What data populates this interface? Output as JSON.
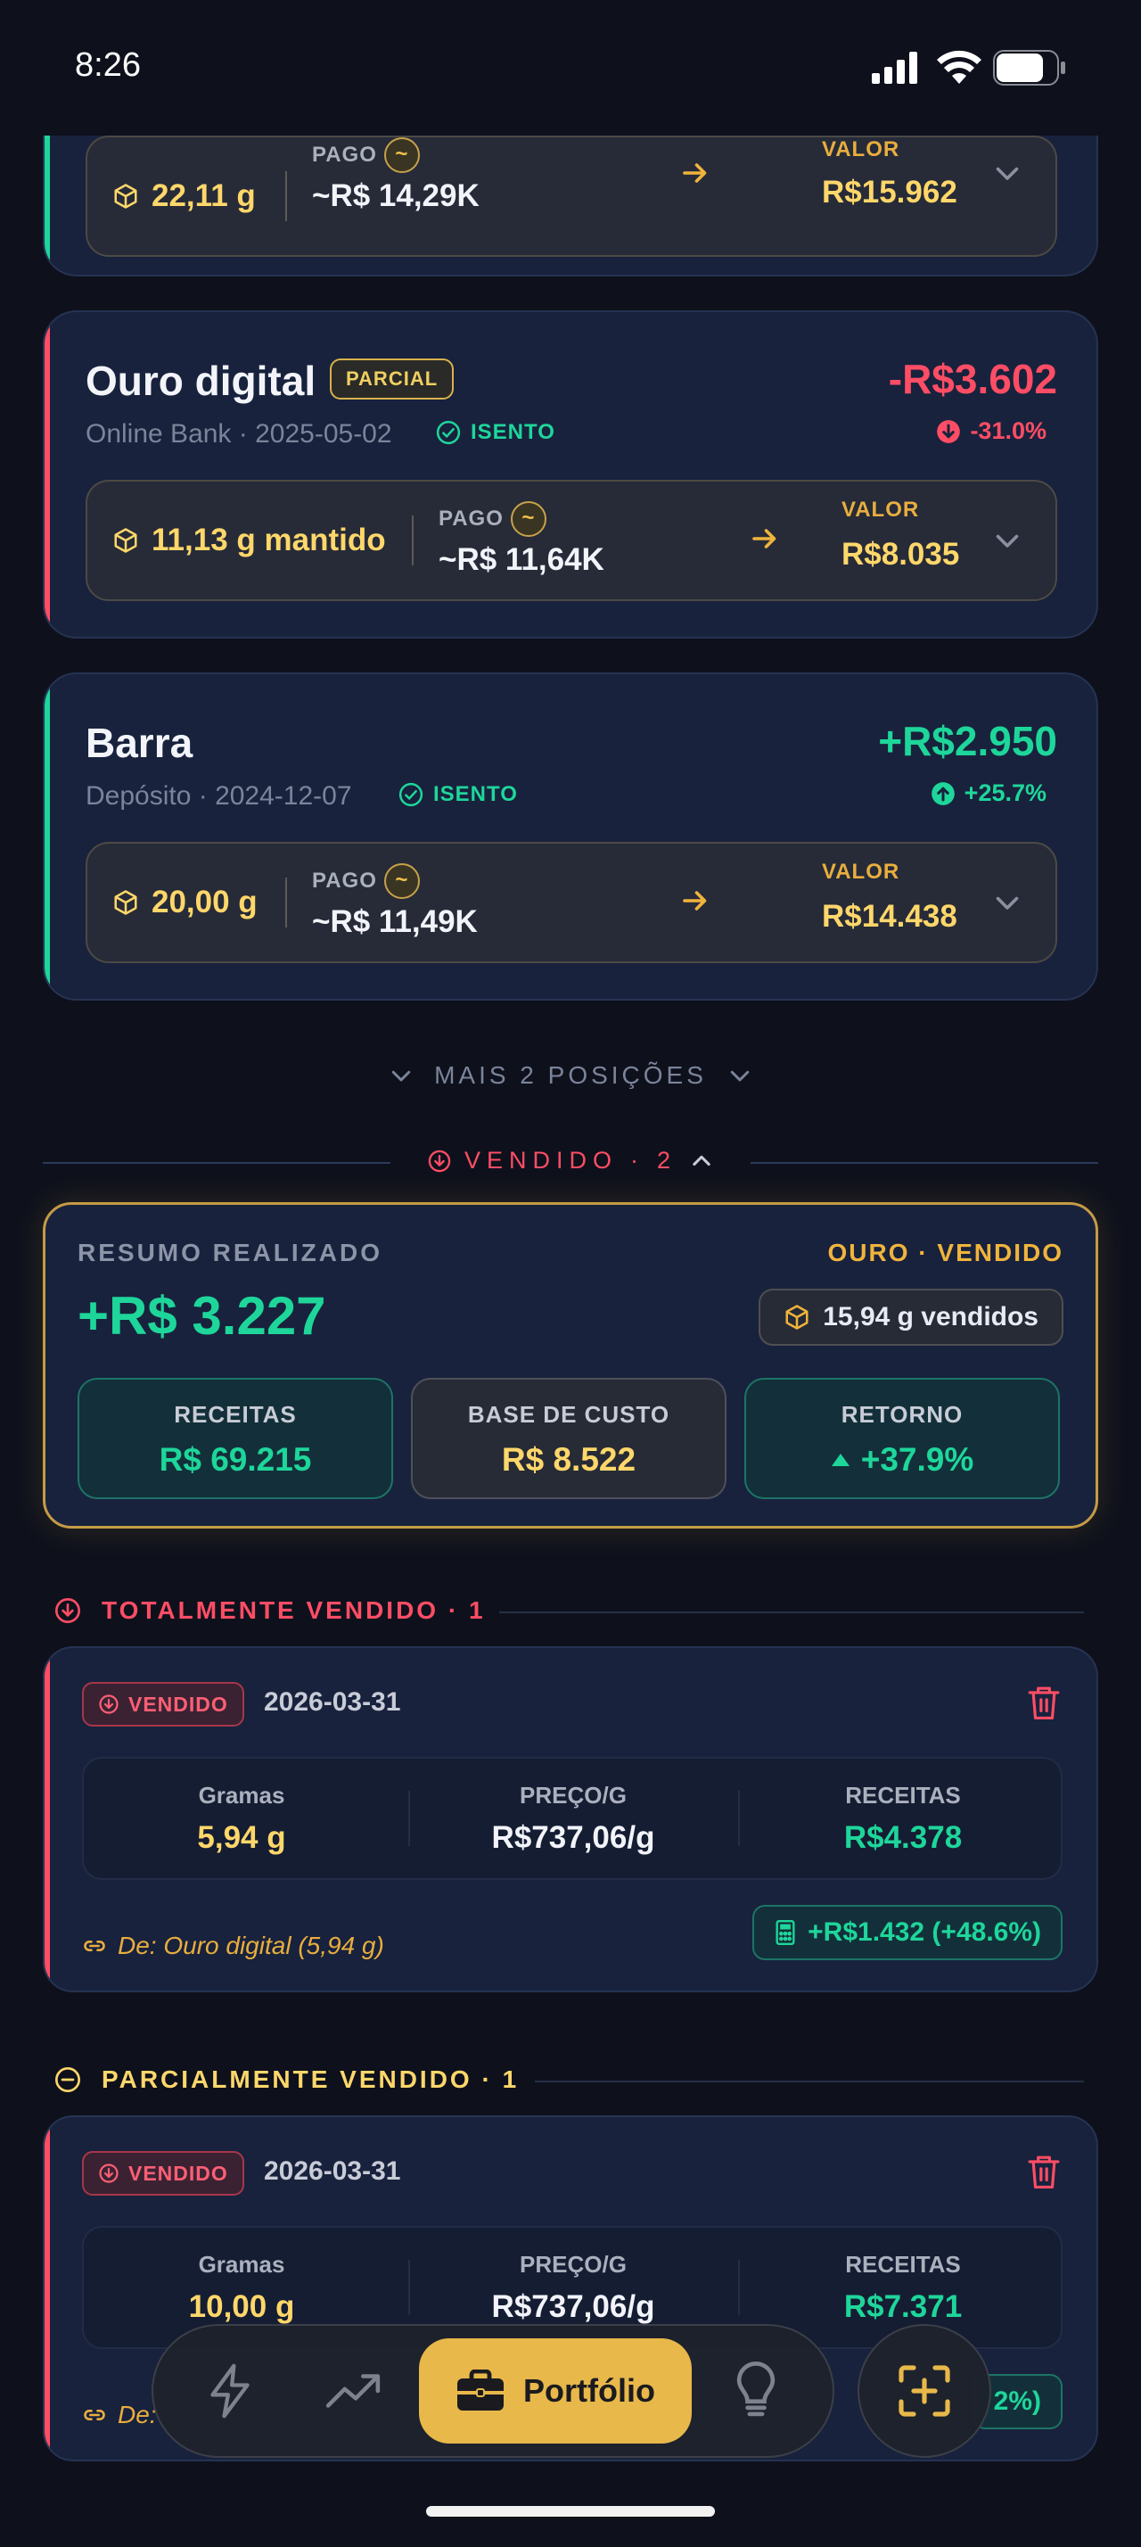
{
  "status_bar": {
    "time": "8:26"
  },
  "positions": [
    {
      "grams": "22,11 g",
      "paid_label": "PAGO",
      "paid_value": "~R$ 14,29K",
      "value_label": "VALOR",
      "value": "R$15.962"
    },
    {
      "title": "Ouro digital",
      "badge": "PARCIAL",
      "subtitle": "Online Bank · 2025-05-02",
      "tax": "ISENTO",
      "pl": "-R$3.602",
      "pl_pct": "-31.0%",
      "grams": "11,13 g mantido",
      "paid_label": "PAGO",
      "paid_value": "~R$ 11,64K",
      "value_label": "VALOR",
      "value": "R$8.035"
    },
    {
      "title": "Barra",
      "subtitle": "Depósito · 2024-12-07",
      "tax": "ISENTO",
      "pl": "+R$2.950",
      "pl_pct": "+25.7%",
      "grams": "20,00 g",
      "paid_label": "PAGO",
      "paid_value": "~R$ 11,49K",
      "value_label": "VALOR",
      "value": "R$14.438"
    }
  ],
  "more_positions": "MAIS 2 POSIÇÕES",
  "sold_section": {
    "label": "VENDIDO",
    "dot": "·",
    "count": "2"
  },
  "summary": {
    "title": "RESUMO REALIZADO",
    "tag": "OURO · VENDIDO",
    "total": "+R$ 3.227",
    "sold_grams": "15,94 g vendidos",
    "stats": [
      {
        "label": "RECEITAS",
        "value": "R$ 69.215"
      },
      {
        "label": "BASE DE CUSTO",
        "value": "R$ 8.522"
      },
      {
        "label": "RETORNO",
        "value": "+37.9%"
      }
    ]
  },
  "groups": [
    {
      "heading": "TOTALMENTE VENDIDO · 1",
      "card": {
        "badge": "VENDIDO",
        "date": "2026-03-31",
        "metrics": [
          {
            "label": "Gramas",
            "value": "5,94 g"
          },
          {
            "label": "PREÇO/G",
            "value": "R$737,06/g"
          },
          {
            "label": "RECEITAS",
            "value": "R$4.378"
          }
        ],
        "from": "De: Ouro digital (5,94 g)",
        "gain": "+R$1.432 (+48.6%)"
      }
    },
    {
      "heading": "PARCIALMENTE VENDIDO · 1",
      "card": {
        "badge": "VENDIDO",
        "date": "2026-03-31",
        "metrics": [
          {
            "label": "Gramas",
            "value": "10,00 g"
          },
          {
            "label": "PREÇO/G",
            "value": "R$737,06/g"
          },
          {
            "label": "RECEITAS",
            "value": "R$7.371"
          }
        ],
        "from": "De:",
        "gain_partial": "2%)"
      }
    }
  ],
  "nav": {
    "active_label": "Portfólio"
  },
  "colors": {
    "green": "#1ed69a",
    "red": "#ff4d65",
    "gold": "#f0b43c",
    "card": "#18223d",
    "background": "#0e111c"
  }
}
